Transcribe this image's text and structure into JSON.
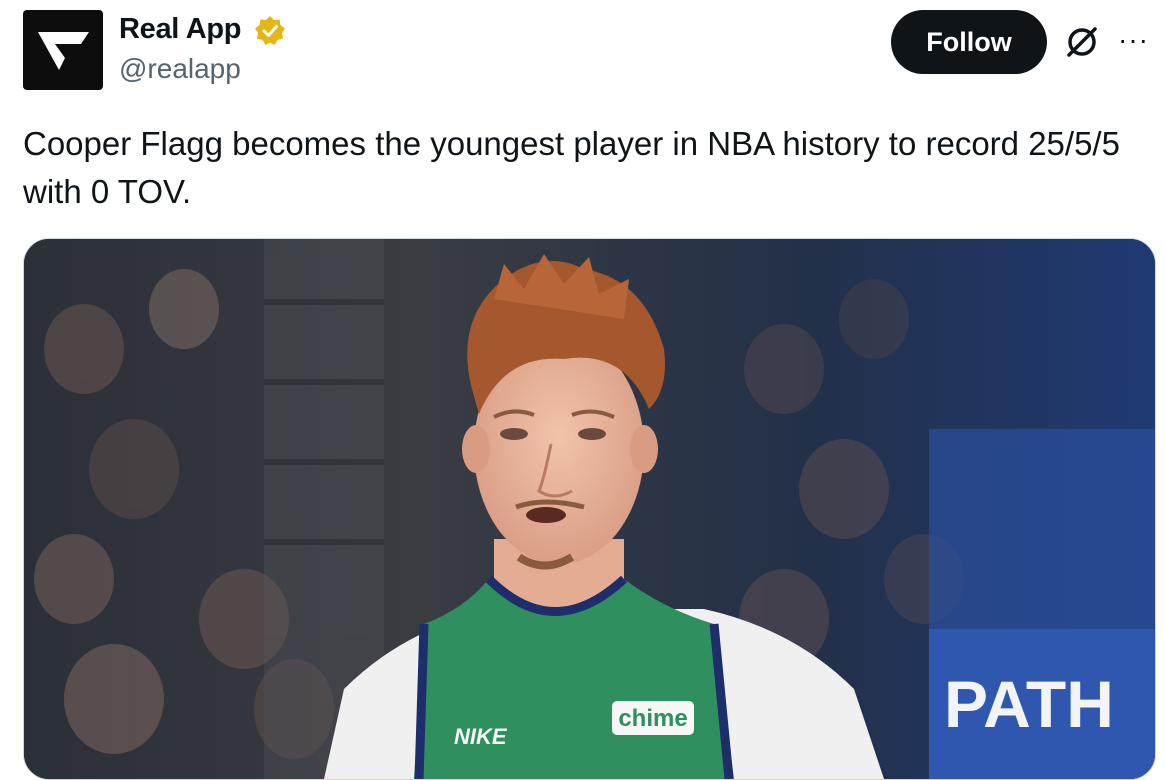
{
  "author": {
    "name": "Real App",
    "handle": "@realapp",
    "verified_icon": "verified-badge-icon",
    "avatar_icon": "real-app-logo-icon"
  },
  "actions": {
    "follow_label": "Follow",
    "grok_icon": "grok-icon",
    "more_icon": "more-icon",
    "more_label": "···"
  },
  "tweet": {
    "text": "Cooper Flagg becomes the youngest player in NBA history to record 25/5/5 with 0 TOV."
  },
  "media": {
    "jersey_sponsor": "chime",
    "jersey_brand": "NIKE",
    "arena_sign": "PATH"
  },
  "colors": {
    "follow_bg": "#0f1419",
    "handle": "#536471",
    "verified": "#e2b719",
    "jersey_green": "#2f8f5f"
  }
}
